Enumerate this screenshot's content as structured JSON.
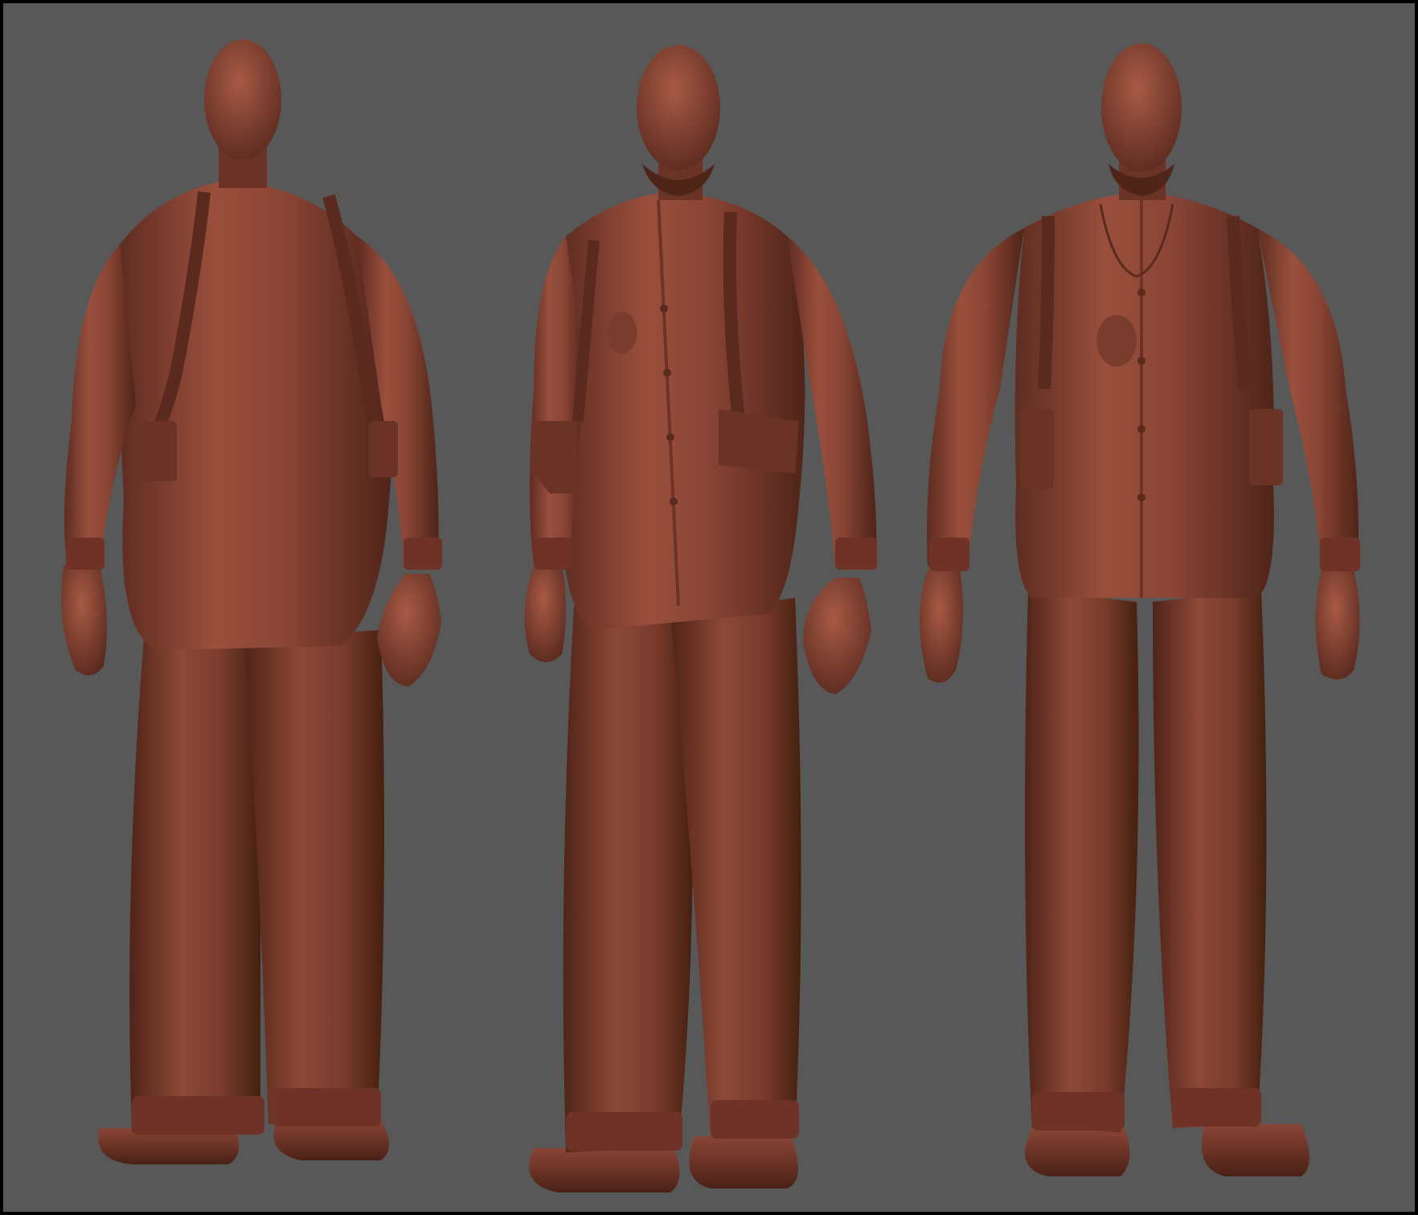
{
  "scene": {
    "colors": {
      "border": "#000000",
      "background": "#585858",
      "clay_base": "#8a4535",
      "clay_light": "#a85a45",
      "clay_dark": "#5e2c21",
      "clay_shadow": "#3f1c15"
    },
    "views": [
      {
        "id": "back",
        "label": ""
      },
      {
        "id": "three-quarter",
        "label": ""
      },
      {
        "id": "front",
        "label": ""
      }
    ]
  }
}
